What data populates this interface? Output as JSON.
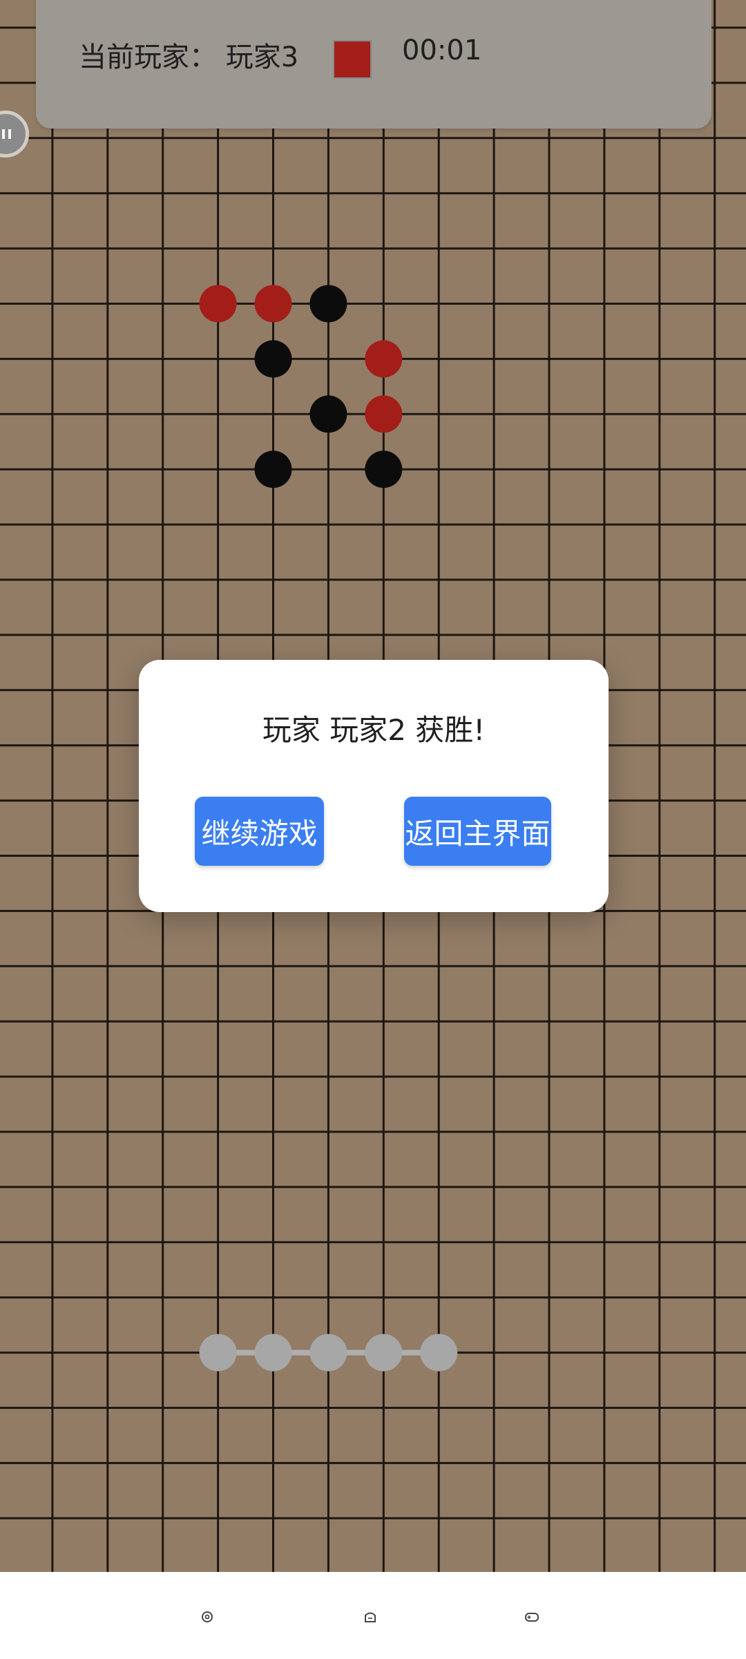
{
  "status": {
    "label": "当前玩家：  玩家3",
    "timer": "00:01",
    "player_color": "#a91f1a"
  },
  "board": {
    "red_color": "#a91f1a",
    "black_color": "#0d0d0d",
    "pieces": [
      {
        "col": 4,
        "row": 5,
        "color": "red"
      },
      {
        "col": 5,
        "row": 5,
        "color": "red"
      },
      {
        "col": 6,
        "row": 5,
        "color": "black"
      },
      {
        "col": 5,
        "row": 6,
        "color": "black"
      },
      {
        "col": 7,
        "row": 6,
        "color": "red"
      },
      {
        "col": 6,
        "row": 7,
        "color": "black"
      },
      {
        "col": 7,
        "row": 7,
        "color": "red"
      },
      {
        "col": 5,
        "row": 8,
        "color": "black"
      },
      {
        "col": 7,
        "row": 8,
        "color": "black"
      }
    ],
    "ghost_pieces": [
      {
        "col": 4,
        "row": 24
      },
      {
        "col": 5,
        "row": 24
      },
      {
        "col": 6,
        "row": 24
      },
      {
        "col": 7,
        "row": 24
      },
      {
        "col": 8,
        "row": 24
      }
    ]
  },
  "dialog": {
    "message": "玩家 玩家2 获胜!",
    "continue_label": "继续游戏",
    "home_label": "返回主界面"
  },
  "nav": {
    "icons": [
      "settings-icon",
      "home-icon",
      "gamepad-icon"
    ]
  }
}
